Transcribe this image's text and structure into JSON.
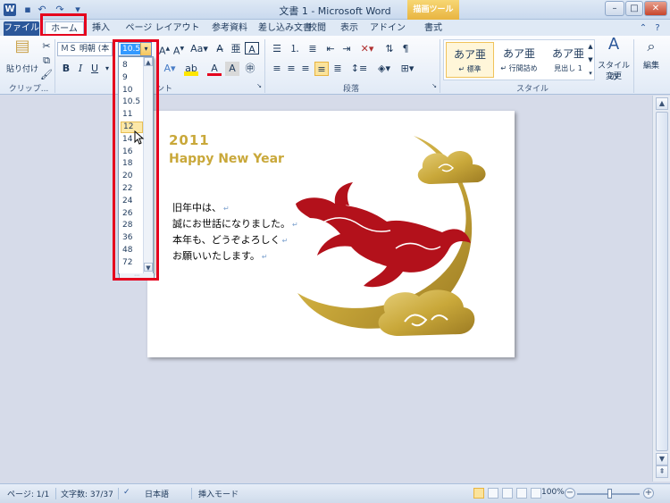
{
  "window": {
    "title": "文書 1 - Microsoft Word",
    "contextual_tab": "描画ツール",
    "app_icon_letter": "W"
  },
  "tabs": {
    "file": "ファイル",
    "home": "ホーム",
    "insert": "挿入",
    "page_layout": "ページ レイアウト",
    "references": "参考資料",
    "mailings": "差し込み文書",
    "review": "校閲",
    "view": "表示",
    "addins": "アドイン",
    "format": "書式"
  },
  "ribbon": {
    "clipboard": {
      "paste_label": "貼り付け",
      "group_label": "クリップ..."
    },
    "font": {
      "font_name": "ＭＳ 明朝 (本",
      "font_size": "10.5",
      "group_label": "ント",
      "bold": "B",
      "italic": "I",
      "underline": "U"
    },
    "paragraph": {
      "group_label": "段落"
    },
    "styles": {
      "group_label": "スタイル",
      "items": [
        {
          "sample": "あア亜",
          "name": "↵ 標準"
        },
        {
          "sample": "あア亜",
          "name": "↵ 行間詰め"
        },
        {
          "sample": "あア亜",
          "name": "見出し 1"
        }
      ],
      "change_styles": "スタイルの",
      "change_styles_2": "変更"
    },
    "editing": {
      "label": "編集"
    }
  },
  "font_size_dropdown": {
    "options": [
      "8",
      "9",
      "10",
      "10.5",
      "11",
      "12",
      "14",
      "16",
      "18",
      "20",
      "22",
      "24",
      "26",
      "28",
      "36",
      "48",
      "72"
    ],
    "hovered": "12"
  },
  "document": {
    "year": "2011",
    "greeting": "Happy New Year",
    "lines": [
      "旧年中は、",
      "誠にお世話になりました。",
      "本年も、どうぞよろしく",
      "お願いいたします。"
    ],
    "return_mark": "↵"
  },
  "status": {
    "page": "ページ: 1/1",
    "word_count": "文字数: 37/37",
    "language": "日本語",
    "mode": "挿入モード",
    "zoom": "100%"
  },
  "colors": {
    "highlight": "#e5001d",
    "gold": "#c9a83a",
    "rabbit": "#b3111b"
  }
}
